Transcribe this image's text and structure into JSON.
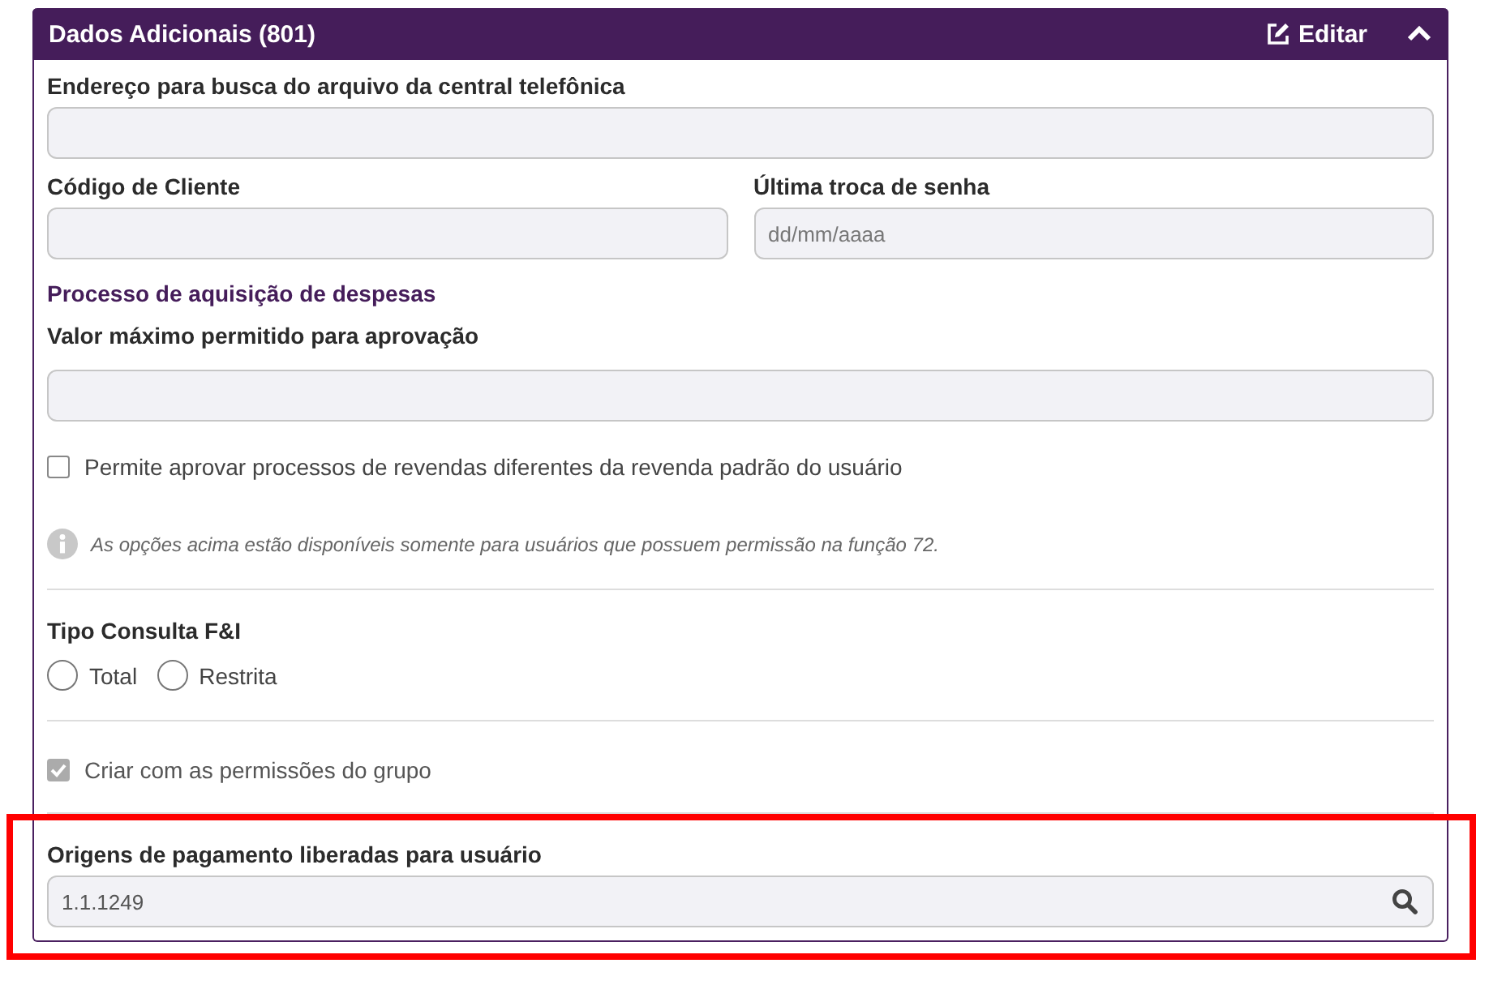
{
  "panel": {
    "title": "Dados Adicionais (801)",
    "edit_label": "Editar",
    "expanded": true
  },
  "items": [
    {
      "kind": "field",
      "label": "Endereço para busca do arquivo da central telefônica"
    },
    {
      "kind": "field_pair",
      "fields": [
        {
          "label": "Código de Cliente"
        },
        {
          "label": "Última troca de senha",
          "placeholder": "dd/mm/aaaa"
        }
      ]
    },
    {
      "kind": "subheading",
      "text": "Processo de aquisição de despesas"
    },
    {
      "kind": "field",
      "label": "Valor máximo permitido para aprovação"
    },
    {
      "kind": "checkbox",
      "label": "Permite aprovar processos de revendas diferentes da revenda padrão do usuário",
      "checked": false,
      "disabled": false
    },
    {
      "kind": "info",
      "text": "As opções acima estão disponíveis somente para usuários que possuem permissão na função 72."
    },
    {
      "kind": "divider"
    },
    {
      "kind": "radio_group",
      "label": "Tipo Consulta F&I",
      "options": [
        {
          "label": "Total",
          "selected": false
        },
        {
          "label": "Restrita",
          "selected": false
        }
      ]
    },
    {
      "kind": "divider"
    },
    {
      "kind": "checkbox",
      "label": "Criar com as permissões do grupo",
      "checked": true,
      "disabled": true
    },
    {
      "kind": "divider"
    },
    {
      "kind": "lookup",
      "label": "Origens de pagamento liberadas para usuário",
      "value": "1.1.1249",
      "highlighted": true
    }
  ]
}
